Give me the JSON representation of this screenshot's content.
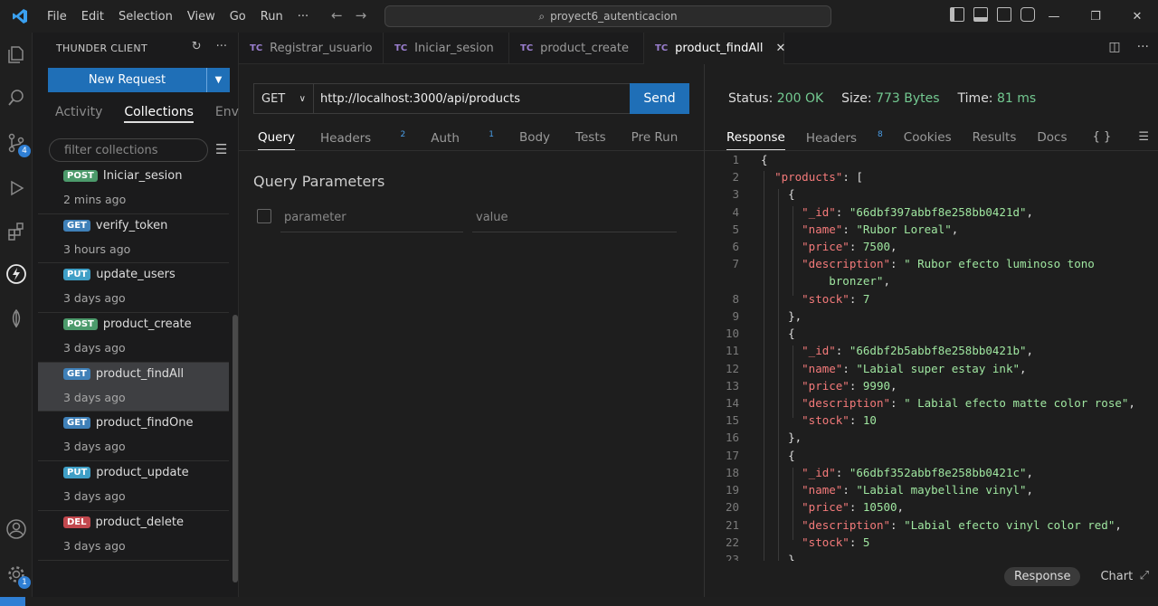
{
  "titlebar": {
    "menu": [
      "File",
      "Edit",
      "Selection",
      "View",
      "Go",
      "Run",
      "···"
    ],
    "search_text": "proyect6_autenticacion"
  },
  "activity_badges": {
    "source_control": "4",
    "settings": "1"
  },
  "sidebar": {
    "title": "THUNDER CLIENT",
    "new_request": "New Request",
    "tabs": [
      "Activity",
      "Collections",
      "Env"
    ],
    "filter_placeholder": "filter collections",
    "items": [
      {
        "method": "POST",
        "name": "Iniciar_sesion",
        "time": "2 mins ago"
      },
      {
        "method": "GET",
        "name": "verify_token",
        "time": "3 hours ago"
      },
      {
        "method": "PUT",
        "name": "update_users",
        "time": "3 days ago"
      },
      {
        "method": "POST",
        "name": "product_create",
        "time": "3 days ago"
      },
      {
        "method": "GET",
        "name": "product_findAll",
        "time": "3 days ago"
      },
      {
        "method": "GET",
        "name": "product_findOne",
        "time": "3 days ago"
      },
      {
        "method": "PUT",
        "name": "product_update",
        "time": "3 days ago"
      },
      {
        "method": "DEL",
        "name": "product_delete",
        "time": "3 days ago"
      }
    ]
  },
  "tabs": [
    {
      "prefix": "TC",
      "label": "Registrar_usuario"
    },
    {
      "prefix": "TC",
      "label": "Iniciar_sesion"
    },
    {
      "prefix": "TC",
      "label": "product_create"
    },
    {
      "prefix": "TC",
      "label": "product_findAll",
      "close": "✕"
    }
  ],
  "request": {
    "method": "GET",
    "url": "http://localhost:3000/api/products",
    "send": "Send",
    "tabs": {
      "query": "Query",
      "headers": "Headers",
      "headers_count": "2",
      "auth": "Auth",
      "auth_count": "1",
      "body": "Body",
      "tests": "Tests",
      "prerun": "Pre Run"
    },
    "query_title": "Query Parameters",
    "param_placeholder": "parameter",
    "value_placeholder": "value"
  },
  "response": {
    "status_label": "Status:",
    "status_value": "200 OK",
    "size_label": "Size:",
    "size_value": "773 Bytes",
    "time_label": "Time:",
    "time_value": "81 ms",
    "tabs": {
      "response": "Response",
      "headers": "Headers",
      "headers_count": "8",
      "cookies": "Cookies",
      "results": "Results",
      "docs": "Docs"
    },
    "braces": "{ }",
    "view_response": "Response",
    "view_chart": "Chart"
  },
  "colors": {
    "accent": "#1f6fb7",
    "status_ok": "#73c991",
    "json_key": "#f47a7a",
    "json_value": "#9fe6a0"
  }
}
